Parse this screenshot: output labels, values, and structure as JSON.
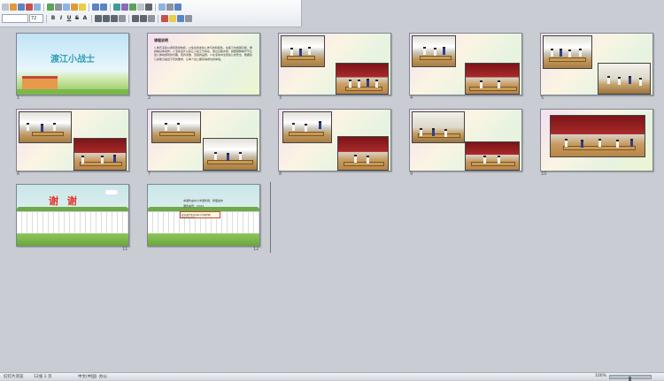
{
  "toolbar": {
    "font_size": "72",
    "row1_icons": [
      "new-icon",
      "open-icon",
      "save-icon",
      "print-icon",
      "preview-icon",
      "spellcheck-icon",
      "cut-icon",
      "copy-icon",
      "paste-icon",
      "format-painter-icon",
      "undo-icon",
      "redo-icon",
      "insert-table-icon",
      "insert-chart-icon",
      "insert-picture-icon",
      "insert-textbox-icon",
      "insert-shape-icon",
      "zoom-icon",
      "help-icon"
    ],
    "row2_icons": [
      "bold-icon",
      "italic-icon",
      "underline-icon",
      "strikethrough-icon",
      "shadow-icon",
      "font-size-increase-icon",
      "align-left-icon",
      "align-center-icon",
      "align-right-icon",
      "bullets-icon",
      "numbering-icon",
      "font-color-icon",
      "fill-color-icon",
      "line-color-icon"
    ]
  },
  "slides": [
    {
      "number": "1",
      "type": "title",
      "title": "渡江小战士"
    },
    {
      "number": "2",
      "type": "text",
      "heading": "课程说明",
      "body": "1.体育活动以游戏贯穿始终，以情境激发幼儿参与的积极性，在练习中发展平衡、攀爬等基本动作。2.活动设计以渡江小战士为情境，通过过独木桥、爬障碍物等环节让幼儿体验游戏的乐趣，培养勇敢、坚强的品质。3.在活动中注意幼儿的安全，根据幼儿的能力提出不同的要求，让每个幼儿都获得成功的体验。"
    },
    {
      "number": "3",
      "type": "photos"
    },
    {
      "number": "4",
      "type": "photos"
    },
    {
      "number": "5",
      "type": "photos"
    },
    {
      "number": "6",
      "type": "photos"
    },
    {
      "number": "7",
      "type": "photos"
    },
    {
      "number": "8",
      "type": "photos"
    },
    {
      "number": "9",
      "type": "photos"
    },
    {
      "number": "10",
      "type": "photos"
    },
    {
      "number": "11",
      "type": "thanks",
      "title": "谢  谢"
    },
    {
      "number": "12",
      "type": "info",
      "line1": "本课件由中小学课件网，整理发布",
      "line2": "课件编号：XXXX",
      "box": "更多课件请访问中小学课件网 www.kj.com"
    }
  ],
  "statusbar": {
    "slide_info": "幻灯片浏览",
    "count": "12张  1 页",
    "lang": "中文(中国)",
    "theme": "办公",
    "zoom": "100%"
  }
}
